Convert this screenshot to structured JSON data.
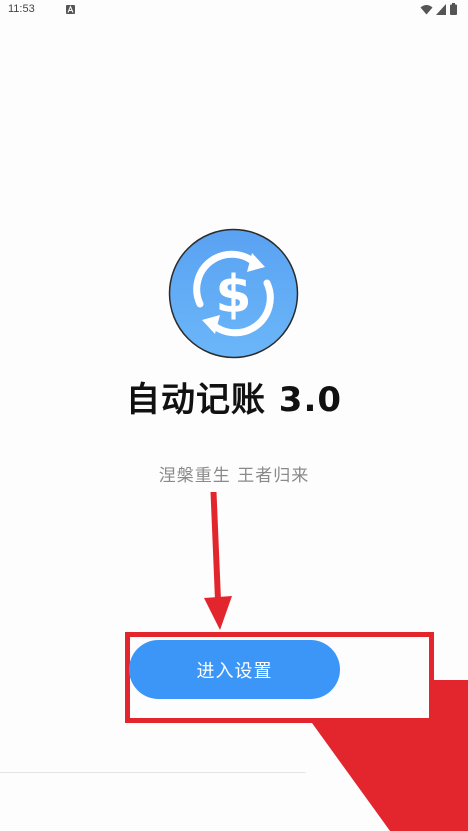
{
  "status_bar": {
    "time": "11:53",
    "left_icon": "a-icon",
    "right_icons": [
      "wifi-icon",
      "signal-icon",
      "battery-icon"
    ]
  },
  "app": {
    "logo_icon": "dollar-refresh-icon",
    "title": "自动记账 3.0",
    "subtitle": "涅槃重生 王者归来"
  },
  "actions": {
    "enter_settings_label": "进入设置"
  },
  "colors": {
    "primary": "#3c96f7",
    "logo_blue": "#5aa8f5",
    "annotation_red": "#e3262e"
  }
}
